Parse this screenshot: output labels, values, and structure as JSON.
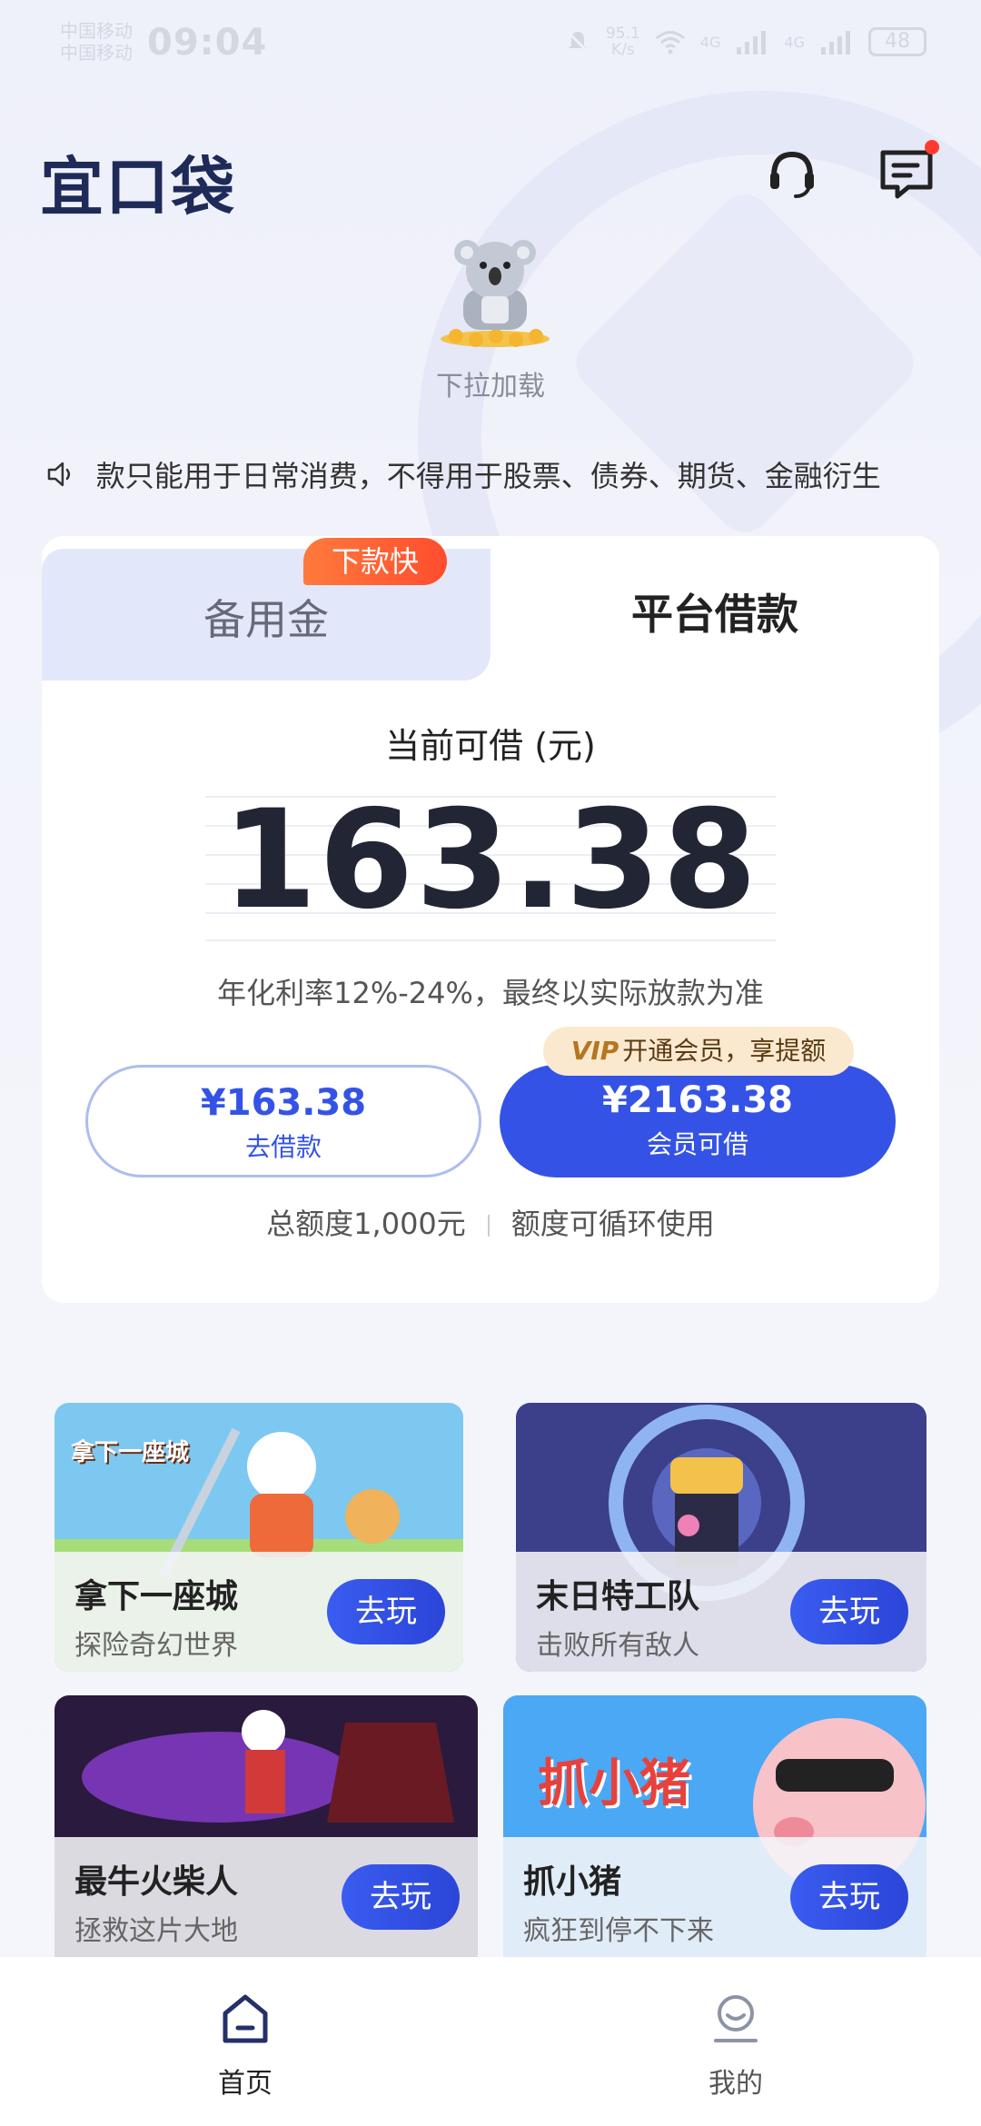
{
  "status_bar": {
    "carrier1": "中国移动",
    "carrier2": "中国移动",
    "time": "09:04",
    "speed_value": "95.1",
    "speed_unit": "K/s",
    "net1": "4G",
    "net2": "4G",
    "battery": "48"
  },
  "header": {
    "logo": "宜口袋",
    "support_icon": "headset-icon",
    "message_icon": "message-icon"
  },
  "refresh": {
    "label": "下拉加载"
  },
  "notice": {
    "text": "款只能用于日常消费，不得用于股票、债券、期货、金融衍生"
  },
  "loan_card": {
    "tabs": [
      {
        "label": "备用金",
        "badge": "下款快",
        "active": false
      },
      {
        "label": "平台借款",
        "active": true
      }
    ],
    "available_title": "当前可借 (元)",
    "available_amount": "163.38",
    "rate_note": "年化利率12%-24%，最终以实际放款为准",
    "borrow_button": {
      "amount": "¥163.38",
      "label": "去借款"
    },
    "member_button": {
      "amount": "¥2163.38",
      "label": "会员可借"
    },
    "vip_tag": {
      "mark": "VIP",
      "text": "开通会员，享提额"
    },
    "quota_total": "总额度1,000元",
    "quota_note": "额度可循环使用"
  },
  "games": [
    {
      "name": "拿下一座城",
      "desc": "探险奇幻世界",
      "button": "去玩",
      "art_title": "拿下一座城"
    },
    {
      "name": "末日特工队",
      "desc": "击败所有敌人",
      "button": "去玩"
    },
    {
      "name": "最牛火柴人",
      "desc": "拯救这片大地",
      "button": "去玩"
    },
    {
      "name": "抓小猪",
      "desc": "疯狂到停不下来",
      "button": "去玩",
      "art_title": "抓小猪"
    }
  ],
  "bottom_nav": [
    {
      "label": "首页",
      "icon": "home-icon",
      "active": true
    },
    {
      "label": "我的",
      "icon": "profile-icon",
      "active": false
    }
  ]
}
